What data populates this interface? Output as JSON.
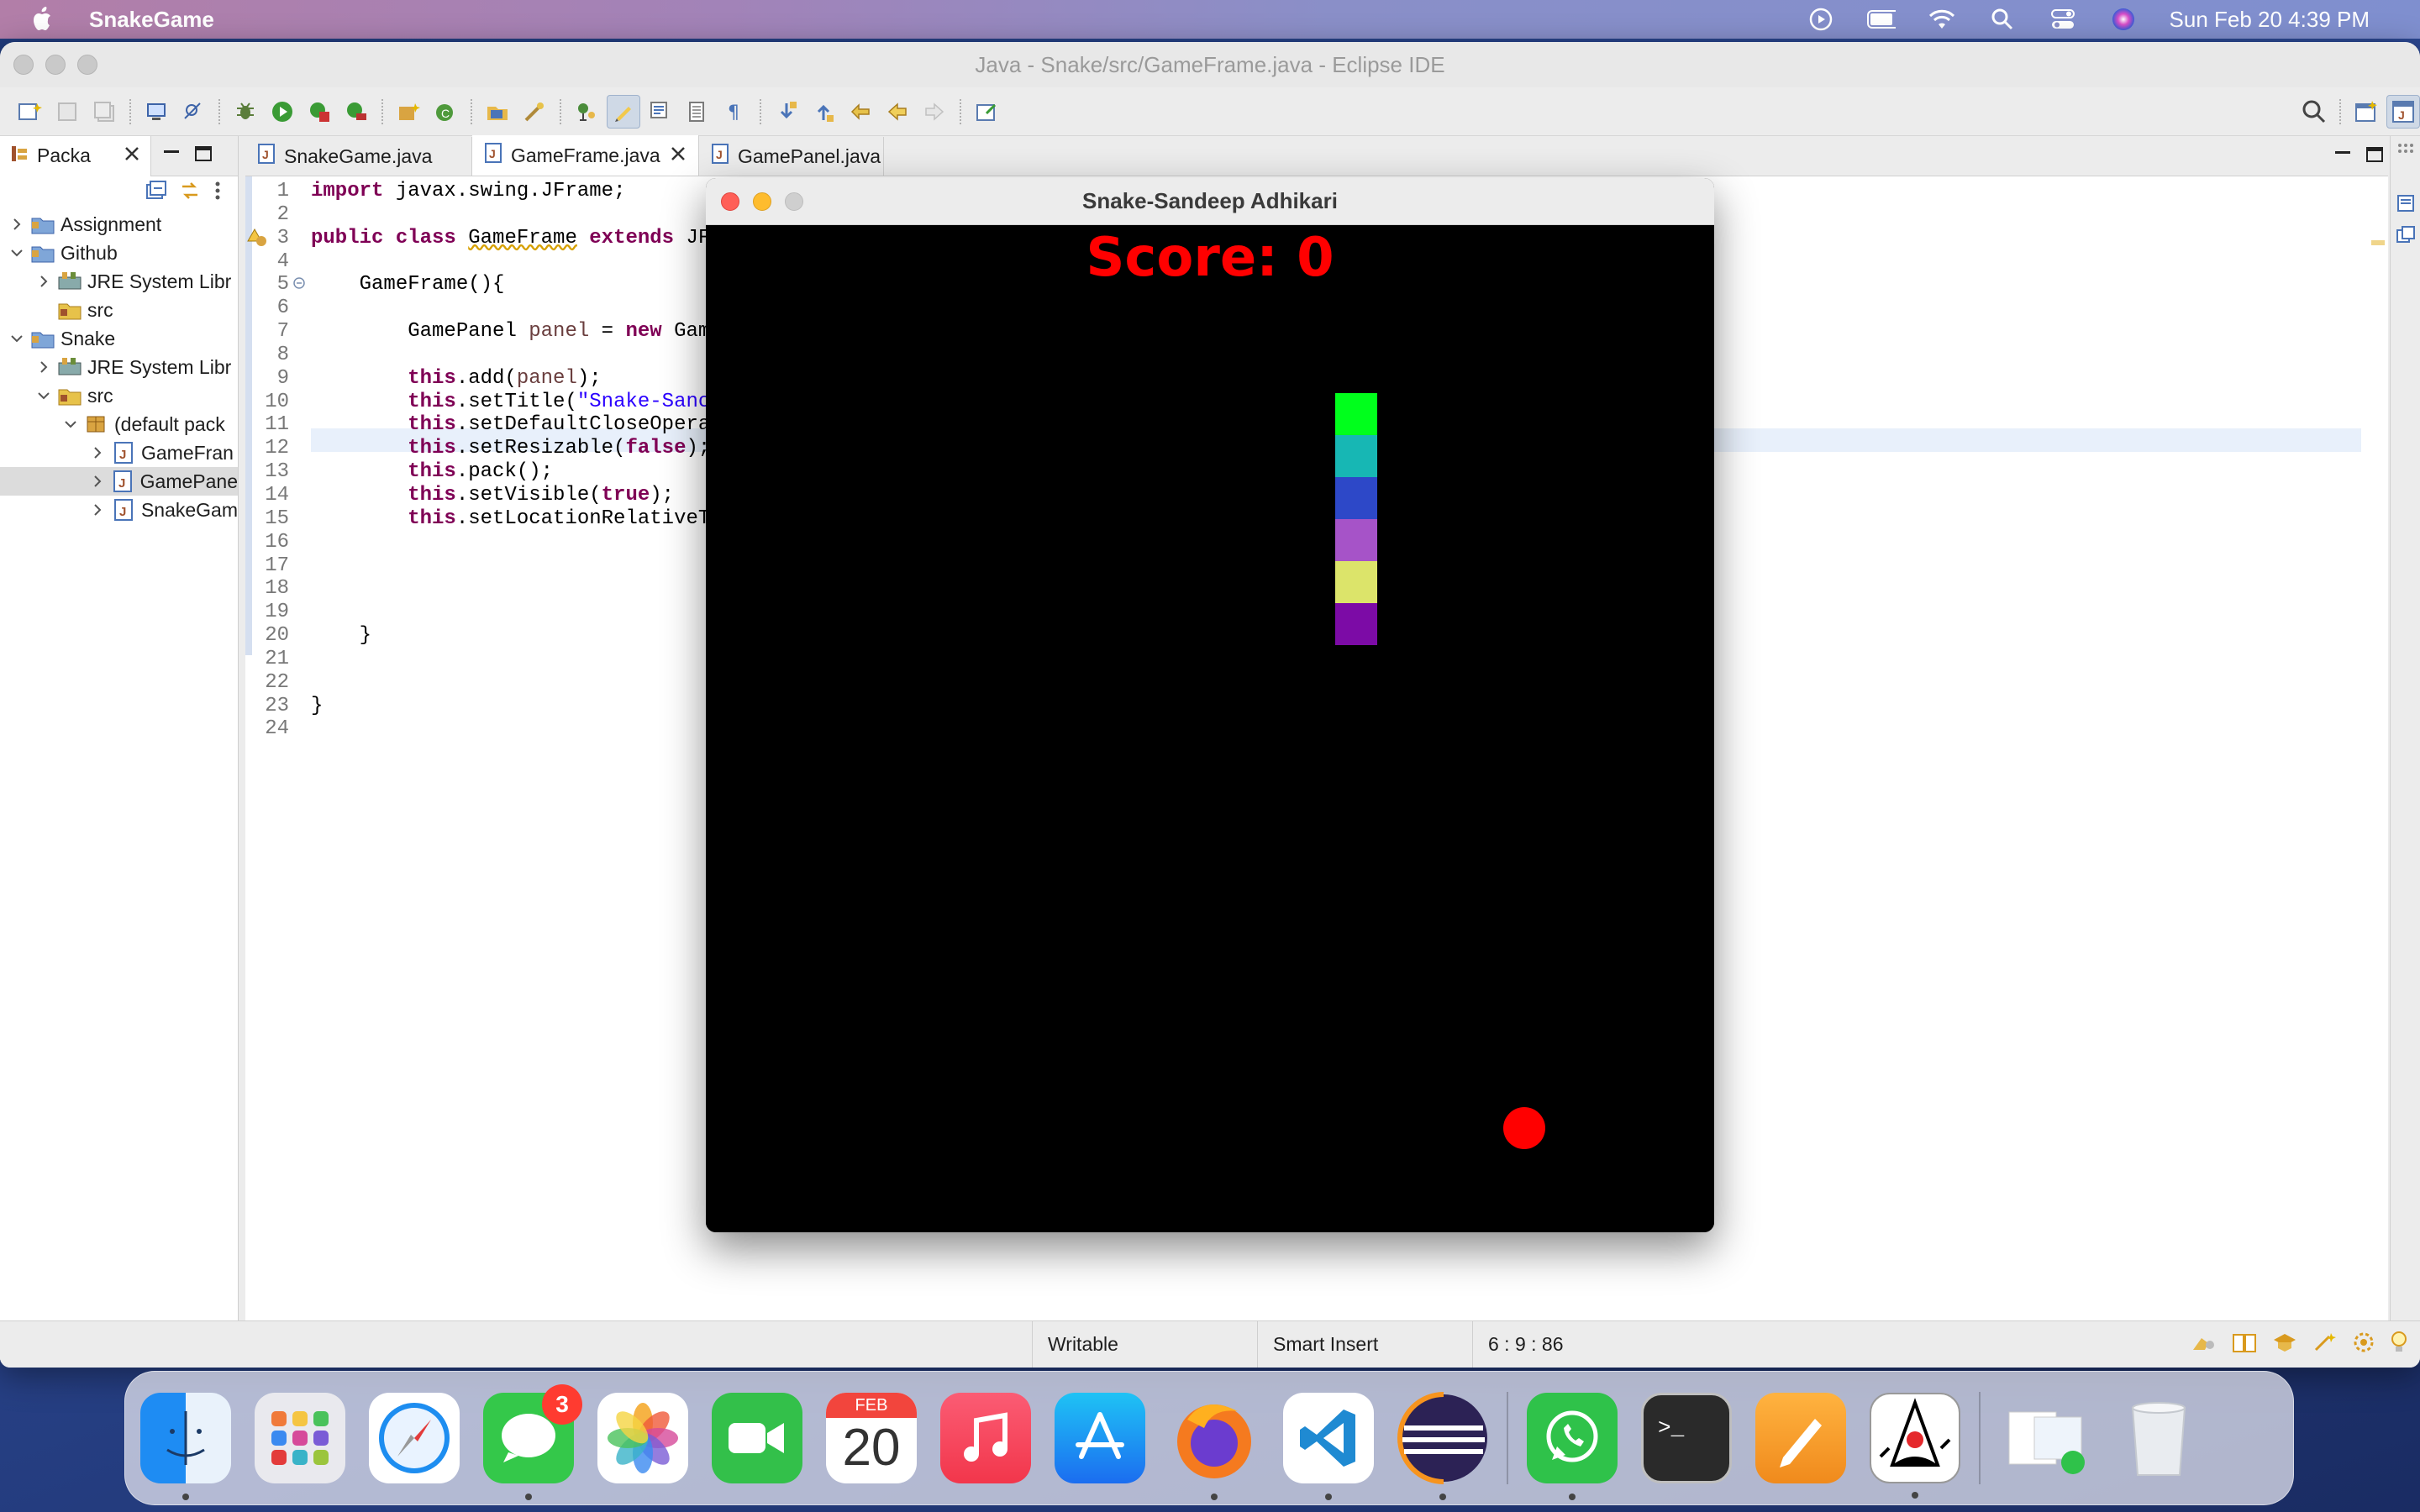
{
  "menubar": {
    "app_name": "SnakeGame",
    "clock": "Sun Feb 20  4:39 PM",
    "icons": [
      "apple-icon",
      "screen-record-icon",
      "battery-icon",
      "wifi-icon",
      "spotlight-icon",
      "control-center-icon",
      "siri-icon"
    ]
  },
  "eclipse": {
    "window_title": "Java - Snake/src/GameFrame.java - Eclipse IDE",
    "package_explorer": {
      "tab_label": "Packa",
      "tree": [
        {
          "label": "Assignment",
          "depth": 0,
          "expanded": false
        },
        {
          "label": "Github",
          "depth": 0,
          "expanded": true
        },
        {
          "label": "JRE System Libr",
          "depth": 1,
          "expanded": false
        },
        {
          "label": "src",
          "depth": 1,
          "expanded": null
        },
        {
          "label": "Snake",
          "depth": 0,
          "expanded": true
        },
        {
          "label": "JRE System Libr",
          "depth": 1,
          "expanded": false
        },
        {
          "label": "src",
          "depth": 1,
          "expanded": true
        },
        {
          "label": "(default pack",
          "depth": 2,
          "expanded": true
        },
        {
          "label": "GameFran",
          "depth": 3,
          "expanded": false
        },
        {
          "label": "GamePane",
          "depth": 3,
          "expanded": false,
          "selected": true
        },
        {
          "label": "SnakeGam",
          "depth": 3,
          "expanded": false
        }
      ]
    },
    "editor_tabs": [
      {
        "label": "SnakeGame.java",
        "active": false
      },
      {
        "label": "GameFrame.java",
        "active": true
      },
      {
        "label": "GamePanel.java",
        "active": false
      }
    ],
    "line_numbers": [
      "1",
      "2",
      "3",
      "4",
      "5",
      "6",
      "7",
      "8",
      "9",
      "10",
      "11",
      "12",
      "13",
      "14",
      "15",
      "16",
      "17",
      "18",
      "19",
      "20",
      "21",
      "22",
      "23",
      "24"
    ],
    "code": {
      "l1_kw": "import",
      "l1_rest": " javax.swing.JFrame;",
      "l3_kw1": "public class",
      "l3_cls": "GameFrame",
      "l3_kw2": "extends",
      "l3_rest": " JF",
      "l5": "    GameFrame(){",
      "l7_a": "        GamePanel ",
      "l7_var": "panel",
      "l7_b": " = ",
      "l7_kw": "new",
      "l7_c": " Gam",
      "l9_kw": "this",
      "l9_a": ".add(",
      "l9_var": "panel",
      "l9_b": ");",
      "l10_kw": "this",
      "l10_a": ".setTitle(",
      "l10_str": "\"Snake-Sanc",
      "l11_kw": "this",
      "l11_a": ".setDefaultCloseOpera",
      "l12_kw": "this",
      "l12_a": ".setResizable(",
      "l12_kw2": "false",
      "l12_b": ");",
      "l13_kw": "this",
      "l13_a": ".pack();",
      "l14_kw": "this",
      "l14_a": ".setVisible(",
      "l14_kw2": "true",
      "l14_b": ");",
      "l15_kw": "this",
      "l15_a": ".setLocationRelativeT",
      "l20": "    }",
      "l23": "}"
    },
    "status": {
      "writable": "Writable",
      "insert_mode": "Smart Insert",
      "position": "6 : 9 : 86"
    }
  },
  "game_window": {
    "title": "Snake-Sandeep Adhikari",
    "score_text": "Score: 0",
    "snake_colors": [
      "#00ff1c",
      "#17b7b4",
      "#2d48c8",
      "#a653c8",
      "#dce46a",
      "#7c0ba6"
    ],
    "apple_color": "#ff0000"
  },
  "dock": {
    "apps": [
      {
        "name": "finder",
        "running": true
      },
      {
        "name": "launchpad",
        "running": false
      },
      {
        "name": "safari",
        "running": false
      },
      {
        "name": "messages",
        "running": true,
        "badge": "3"
      },
      {
        "name": "photos",
        "running": false
      },
      {
        "name": "facetime",
        "running": false
      },
      {
        "name": "calendar",
        "running": false,
        "month": "FEB",
        "day": "20"
      },
      {
        "name": "music",
        "running": false
      },
      {
        "name": "app-store",
        "running": false
      },
      {
        "name": "firefox",
        "running": true
      },
      {
        "name": "vscode",
        "running": true
      },
      {
        "name": "eclipse",
        "running": true
      },
      {
        "name": "whatsapp",
        "running": true
      },
      {
        "name": "terminal",
        "running": false
      },
      {
        "name": "pages",
        "running": false
      },
      {
        "name": "java-duke",
        "running": true
      },
      {
        "name": "downloads-stack",
        "running": false
      },
      {
        "name": "trash",
        "running": false
      }
    ]
  }
}
